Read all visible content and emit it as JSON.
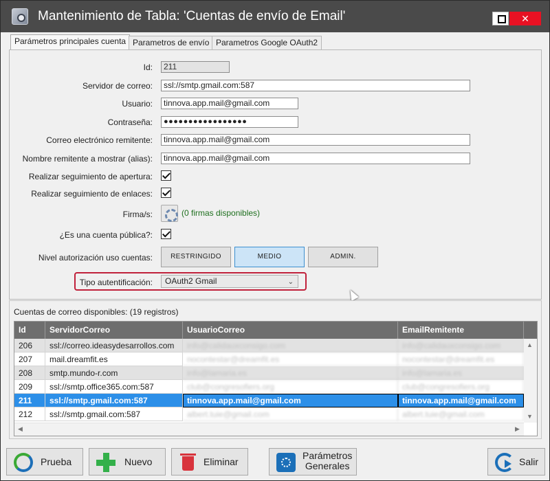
{
  "window": {
    "title": "Mantenimiento de Tabla: 'Cuentas de envío de Email'",
    "close_glyph": "✕"
  },
  "tabs": [
    {
      "label": "Parámetros principales cuenta",
      "active": true
    },
    {
      "label": "Parametros de envío",
      "active": false
    },
    {
      "label": "Parametros Google OAuth2",
      "active": false
    }
  ],
  "form": {
    "id": {
      "label": "Id:",
      "value": "211"
    },
    "servidor": {
      "label": "Servidor de correo:",
      "value": "ssl://smtp.gmail.com:587"
    },
    "usuario": {
      "label": "Usuario:",
      "value": "tinnova.app.mail@gmail.com"
    },
    "contrasena": {
      "label": "Contraseña:",
      "value": "●●●●●●●●●●●●●●●●●"
    },
    "remitente": {
      "label": "Correo electrónico remitente:",
      "value": "tinnova.app.mail@gmail.com"
    },
    "alias": {
      "label": "Nombre remitente a mostrar (alias):",
      "value": "tinnova.app.mail@gmail.com"
    },
    "seguimiento_apertura": {
      "label": "Realizar seguimiento de apertura:",
      "checked": true
    },
    "seguimiento_enlaces": {
      "label": "Realizar seguimiento de enlaces:",
      "checked": true
    },
    "firmas": {
      "label": "Firma/s:",
      "info": "(0 firmas disponibles)"
    },
    "cuenta_publica": {
      "label": "¿Es una cuenta pública?:",
      "checked": true
    },
    "nivel": {
      "label": "Nivel autorización uso cuentas:",
      "options": [
        "RESTRINGIDO",
        "MEDIO",
        "ADMIN."
      ],
      "selected": "MEDIO"
    },
    "tipo_auth": {
      "label": "Tipo autentificación:",
      "value": "OAuth2 Gmail"
    }
  },
  "grid": {
    "title": "Cuentas de correo disponibles:",
    "count": "(19 registros)",
    "columns": [
      "Id",
      "ServidorCorreo",
      "UsuarioCorreo",
      "EmailRemitente"
    ],
    "rows": [
      {
        "id": "206",
        "servidor": "ssl://correo.ideasydesarrollos.com",
        "usuario": "info@calidauxconsigo.com",
        "remitente": "info@calidauxconsigo.com"
      },
      {
        "id": "207",
        "servidor": "mail.dreamfit.es",
        "usuario": "nocontestar@dreamfit.es",
        "remitente": "nocontestar@dreamfit.es"
      },
      {
        "id": "208",
        "servidor": "smtp.mundo-r.com",
        "usuario": "info@lamaria.es",
        "remitente": "info@lamaria.es"
      },
      {
        "id": "209",
        "servidor": "ssl://smtp.office365.com:587",
        "usuario": "club@congresofiers.org",
        "remitente": "club@congresofiers.org"
      },
      {
        "id": "211",
        "servidor": "ssl://smtp.gmail.com:587",
        "usuario": "tinnova.app.mail@gmail.com",
        "remitente": "tinnova.app.mail@gmail.com"
      },
      {
        "id": "212",
        "servidor": "ssl://smtp.gmail.com:587",
        "usuario": "albert.tuie@gmail.com",
        "remitente": "albert.tuie@gmail.com"
      }
    ],
    "selected_id": "211"
  },
  "buttons": {
    "prueba": "Prueba",
    "nuevo": "Nuevo",
    "eliminar": "Eliminar",
    "parametros_line1": "Parámetros",
    "parametros_line2": "Generales",
    "salir": "Salir"
  },
  "icons": {
    "prueba": "refresh-icon",
    "nuevo": "plus-icon",
    "eliminar": "trash-icon",
    "parametros": "gear-icon",
    "salir": "exit-icon"
  },
  "colors": {
    "titlebar": "#4a4a4a",
    "close": "#e81123",
    "selected_row": "#2c8fe8",
    "highlight": "#c0203a",
    "nivel_selected": "#cce4f7"
  }
}
